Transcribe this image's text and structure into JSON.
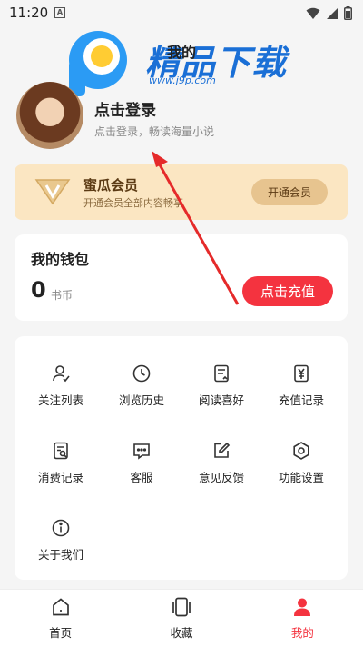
{
  "status": {
    "time": "11:20",
    "a_icon": "A"
  },
  "header": {
    "title": "我的"
  },
  "watermark": {
    "brand": "精品下载",
    "url": "www.j9p.com"
  },
  "user": {
    "login_title": "点击登录",
    "login_subtitle": "点击登录，畅读海量小说"
  },
  "vip": {
    "title": "蜜瓜会员",
    "subtitle": "开通会员全部内容畅享",
    "button": "开通会员",
    "icon": "vip-badge-icon"
  },
  "wallet": {
    "title": "我的钱包",
    "amount": "0",
    "unit": "书币",
    "recharge": "点击充值",
    "accent": "#f4333f"
  },
  "menu": {
    "items": [
      {
        "label": "关注列表",
        "icon": "follow-user-icon"
      },
      {
        "label": "浏览历史",
        "icon": "history-clock-icon"
      },
      {
        "label": "阅读喜好",
        "icon": "reading-preference-icon"
      },
      {
        "label": "充值记录",
        "icon": "recharge-record-icon"
      },
      {
        "label": "消费记录",
        "icon": "consumption-record-icon"
      },
      {
        "label": "客服",
        "icon": "customer-service-icon"
      },
      {
        "label": "意见反馈",
        "icon": "feedback-edit-icon"
      },
      {
        "label": "功能设置",
        "icon": "settings-gear-icon"
      },
      {
        "label": "关于我们",
        "icon": "info-icon"
      }
    ]
  },
  "tabs": [
    {
      "label": "首页",
      "icon": "home-icon"
    },
    {
      "label": "收藏",
      "icon": "bookshelf-icon"
    },
    {
      "label": "我的",
      "icon": "profile-icon",
      "active": true
    }
  ]
}
